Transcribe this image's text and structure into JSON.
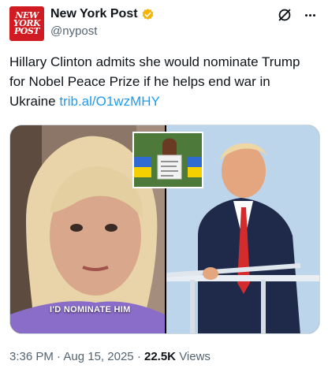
{
  "account": {
    "display_name": "New York Post",
    "handle": "@nypost",
    "avatar_lines": [
      "NEW",
      "YORK",
      "POST"
    ],
    "verified": true,
    "verified_color": "#f4b400",
    "avatar_color": "#d11b22"
  },
  "actions": {
    "grok_icon": "grok-slash-icon",
    "more_icon": "more-horizontal-icon"
  },
  "tweet": {
    "text": "Hillary Clinton admits she would nominate Trump for Nobel Peace Prize if he helps end war in Ukraine",
    "link": "trib.al/O1wzMHY",
    "link_color": "#1d9bf0"
  },
  "media": {
    "caption": "I'D NOMINATE HIM",
    "inset_sign": "Mr. Trump no deals with Putin"
  },
  "meta": {
    "time": "3:36 PM",
    "separator": "·",
    "date": "Aug 15, 2025",
    "views_count": "22.5K",
    "views_label": "Views"
  }
}
